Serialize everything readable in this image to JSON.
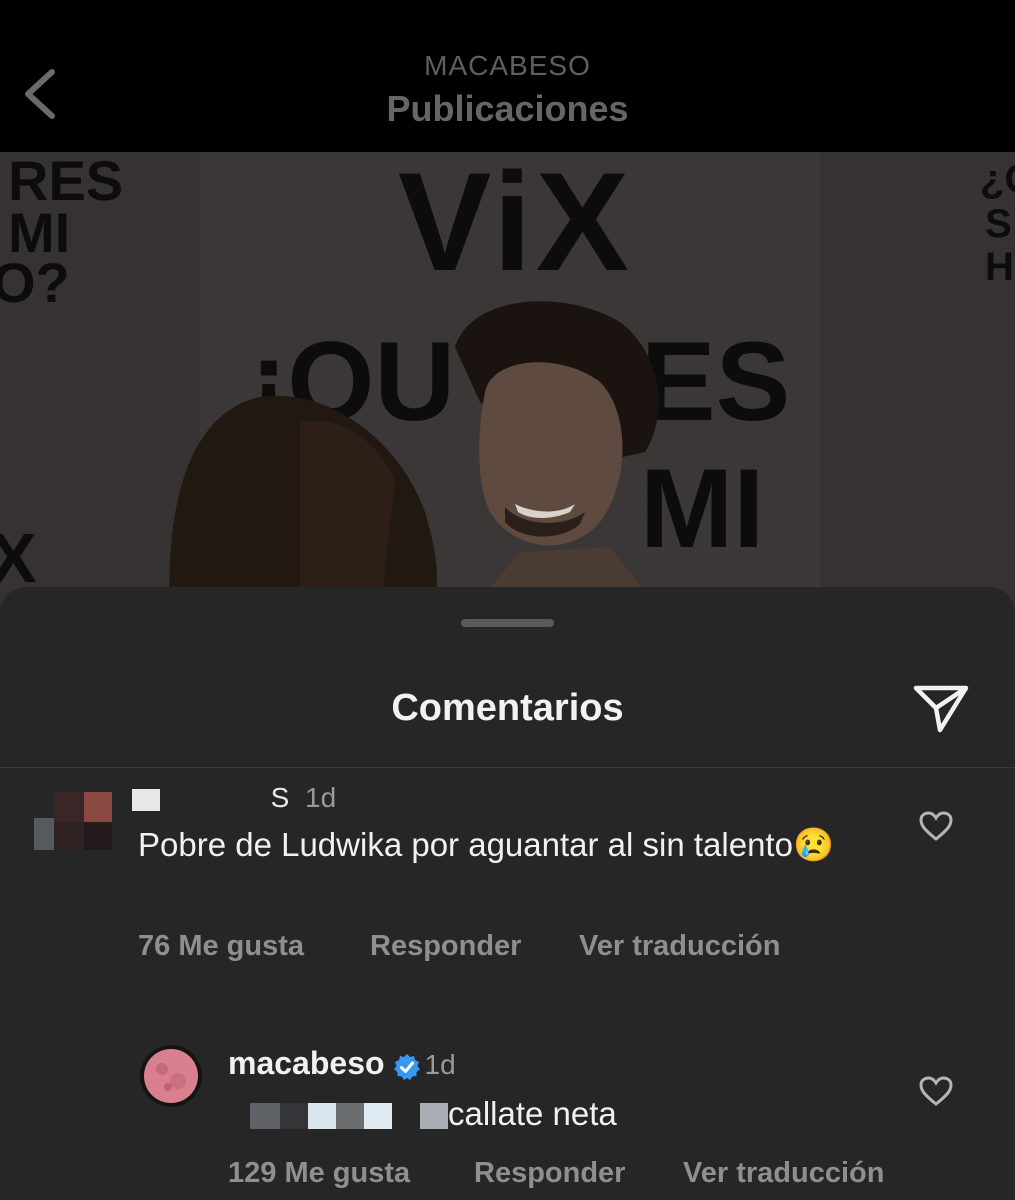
{
  "header": {
    "account": "MACABESO",
    "title": "Publicaciones",
    "back_icon": "chevron-left-icon"
  },
  "post_image": {
    "logo_text": "ViX",
    "banner_left": [
      "RES",
      "MI",
      "O?"
    ],
    "banner_center": [
      "¡QU",
      "RES",
      "MI"
    ],
    "banner_right": [
      "¿Q",
      "S",
      "H"
    ],
    "banner_bottom_left": "X"
  },
  "sheet": {
    "title": "Comentarios",
    "share_icon": "paper-plane-icon"
  },
  "comments": [
    {
      "username_partial": "S",
      "time": "1d",
      "text": "Pobre de Ludwika por aguantar al sin talento",
      "emoji": "😢",
      "likes": "76 Me gusta",
      "reply": "Responder",
      "translate": "Ver traducción",
      "heart_icon": "heart-outline-icon"
    },
    {
      "username": "macabeso",
      "verified": true,
      "time": "1d",
      "text": "callate neta",
      "likes": "129 Me gusta",
      "reply": "Responder",
      "translate": "Ver traducción",
      "heart_icon": "heart-outline-icon"
    }
  ],
  "colors": {
    "background": "#000000",
    "sheet": "#262626",
    "muted_text": "#8f8f8f",
    "verified_blue": "#3897f0"
  }
}
